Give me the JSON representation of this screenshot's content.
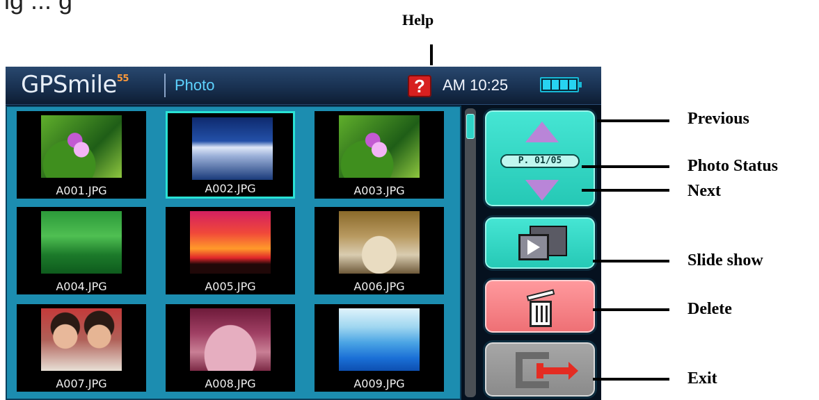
{
  "top_caption": "ig ... g",
  "callouts": {
    "help": "Help",
    "previous": "Previous",
    "photo_status": "Photo Status",
    "next": "Next",
    "slide_show": "Slide show",
    "delete": "Delete",
    "exit": "Exit"
  },
  "titlebar": {
    "logo_text": "GPSmile",
    "logo_superscript": "55",
    "app_title": "Photo",
    "help_button": "?",
    "clock": "AM 10:25",
    "battery_level": 1.0
  },
  "photos": [
    {
      "name": "A001.JPG",
      "icon": "lotus-photo",
      "selected": false
    },
    {
      "name": "A002.JPG",
      "icon": "waterfall-photo",
      "selected": true
    },
    {
      "name": "A003.JPG",
      "icon": "lotus-photo",
      "selected": false
    },
    {
      "name": "A004.JPG",
      "icon": "green-hills-photo",
      "selected": false
    },
    {
      "name": "A005.JPG",
      "icon": "sunset-photo",
      "selected": false
    },
    {
      "name": "A006.JPG",
      "icon": "grass-photo",
      "selected": false
    },
    {
      "name": "A007.JPG",
      "icon": "kids-photo",
      "selected": false
    },
    {
      "name": "A008.JPG",
      "icon": "pink-flowers-photo",
      "selected": false
    },
    {
      "name": "A009.JPG",
      "icon": "blue-mountains-photo",
      "selected": false
    }
  ],
  "navigator": {
    "page_status": "P. 01/05"
  },
  "colors": {
    "accent_teal": "#2fd2c6",
    "delete_red": "#ee6f74",
    "exit_gray": "#8a8a8a",
    "help_red": "#d72020",
    "selection": "#29e3d5"
  }
}
